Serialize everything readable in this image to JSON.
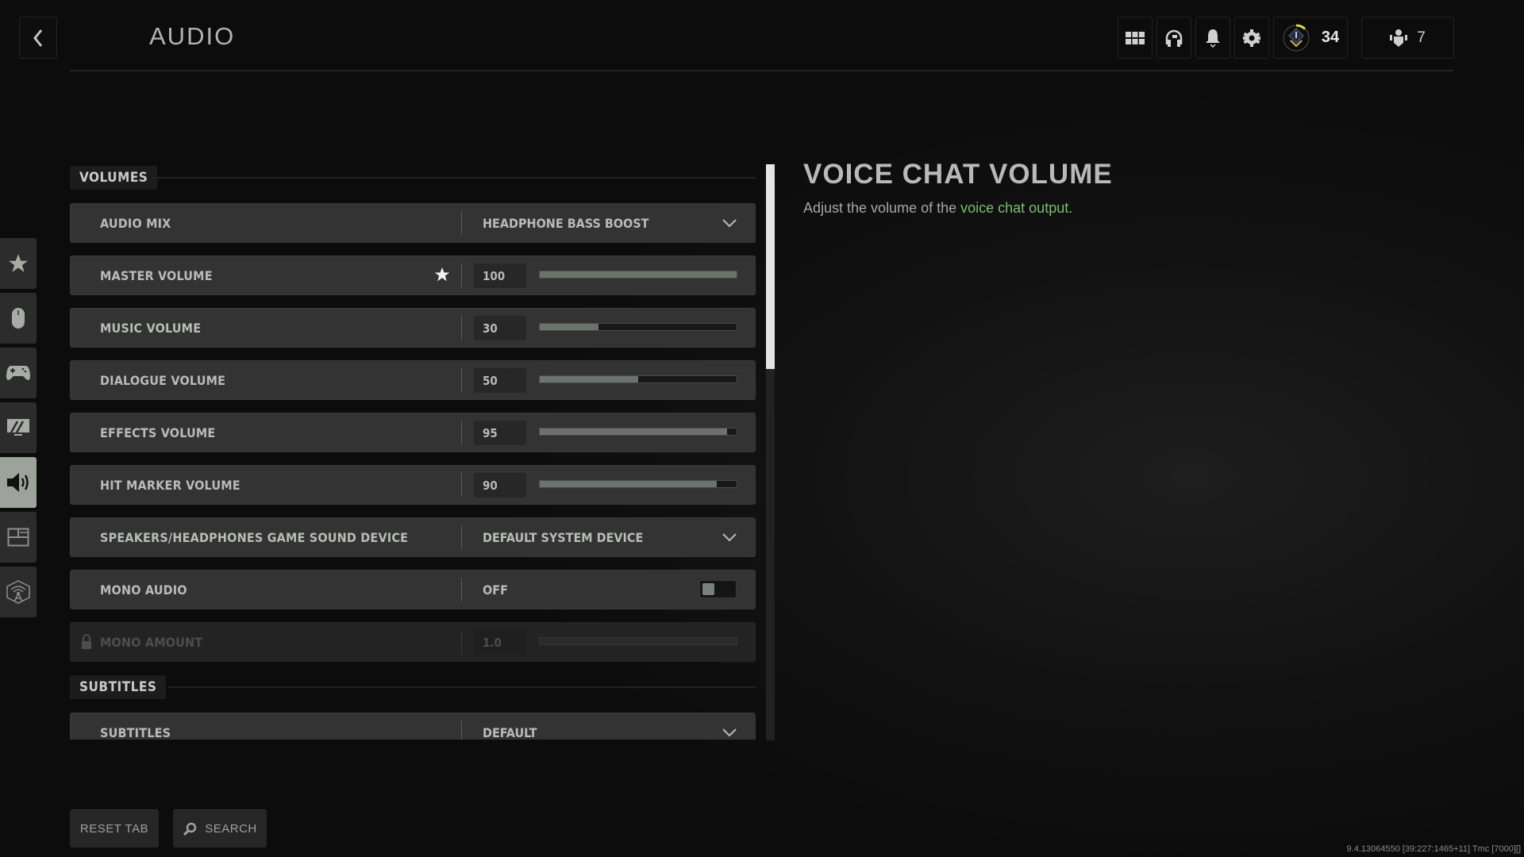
{
  "header": {
    "title": "AUDIO",
    "rank_level": "34",
    "friends_count": "7",
    "icons": [
      "grid-menu-icon",
      "headset-icon",
      "bell-icon",
      "gear-icon",
      "rank-icon",
      "friends-icon"
    ]
  },
  "sidebar": {
    "items": [
      {
        "name": "favorites",
        "icon": "star-icon",
        "active": false
      },
      {
        "name": "mouse-keyboard",
        "icon": "mouse-icon",
        "active": false
      },
      {
        "name": "controller",
        "icon": "gamepad-icon",
        "active": false
      },
      {
        "name": "graphics",
        "icon": "monitor-icon",
        "active": false
      },
      {
        "name": "audio",
        "icon": "speaker-icon",
        "active": true
      },
      {
        "name": "interface",
        "icon": "layout-icon",
        "active": false
      },
      {
        "name": "account-network",
        "icon": "network-icon",
        "active": false
      }
    ]
  },
  "sections": {
    "volumes": "VOLUMES",
    "subtitles": "SUBTITLES"
  },
  "settings": {
    "audio_mix": {
      "label": "AUDIO MIX",
      "value": "HEADPHONE BASS BOOST"
    },
    "master_volume": {
      "label": "MASTER VOLUME",
      "value": "100",
      "percent": 100,
      "favorite": true
    },
    "music_volume": {
      "label": "MUSIC VOLUME",
      "value": "30",
      "percent": 30
    },
    "dialogue_volume": {
      "label": "DIALOGUE VOLUME",
      "value": "50",
      "percent": 50
    },
    "effects_volume": {
      "label": "EFFECTS VOLUME",
      "value": "95",
      "percent": 95
    },
    "hit_marker_volume": {
      "label": "HIT MARKER VOLUME",
      "value": "90",
      "percent": 90
    },
    "sound_device": {
      "label": "SPEAKERS/HEADPHONES GAME SOUND DEVICE",
      "value": "DEFAULT SYSTEM DEVICE"
    },
    "mono_audio": {
      "label": "MONO AUDIO",
      "value": "OFF",
      "on": false
    },
    "mono_amount": {
      "label": "MONO AMOUNT",
      "value": "1.0",
      "percent": 100,
      "locked": true
    },
    "subtitles": {
      "label": "SUBTITLES",
      "value": "DEFAULT"
    }
  },
  "detail": {
    "title": "VOICE CHAT VOLUME",
    "desc_prefix": "Adjust the volume of the ",
    "desc_highlight": "voice chat output.",
    "highlight_color": "#78c06b"
  },
  "footer": {
    "reset_label": "RESET TAB",
    "search_label": "SEARCH"
  },
  "build_info": "9.4.13064550 [39:227:1465+11] Tmc [7000][]"
}
